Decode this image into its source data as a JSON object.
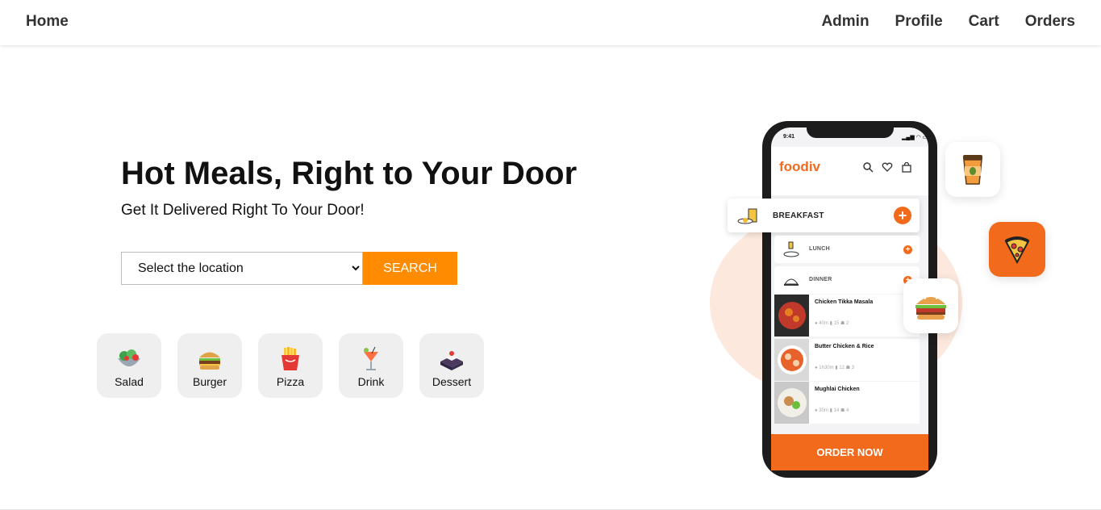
{
  "nav": {
    "home": "Home",
    "links": [
      "Admin",
      "Profile",
      "Cart",
      "Orders"
    ]
  },
  "hero": {
    "title": "Hot Meals, Right to Your Door",
    "subtitle": "Get It Delivered Right To Your Door!",
    "select_value": "Select the location",
    "search_label": "SEARCH"
  },
  "categories": [
    {
      "label": "Salad",
      "icon": "salad-icon"
    },
    {
      "label": "Burger",
      "icon": "burger-icon"
    },
    {
      "label": "Pizza",
      "icon": "fries-icon"
    },
    {
      "label": "Drink",
      "icon": "drink-icon"
    },
    {
      "label": "Dessert",
      "icon": "dessert-icon"
    }
  ],
  "phone": {
    "time": "9:41",
    "brand": "foodiv",
    "menu": [
      "BREAKFAST",
      "LUNCH",
      "DINNER"
    ],
    "dishes": [
      {
        "name": "Chicken Tikka Masala",
        "meta": "● 40m   ▮ 15   ☗ 2"
      },
      {
        "name": "Butter Chicken & Rice",
        "meta": "● 1h30m   ▮ 12   ☗ 3"
      },
      {
        "name": "Mughlai Chicken",
        "meta": "● 30m   ▮ 14   ☗ 4"
      }
    ],
    "order_label": "ORDER NOW"
  },
  "colors": {
    "accent": "#ff8c00",
    "brand": "#f26b1d"
  }
}
